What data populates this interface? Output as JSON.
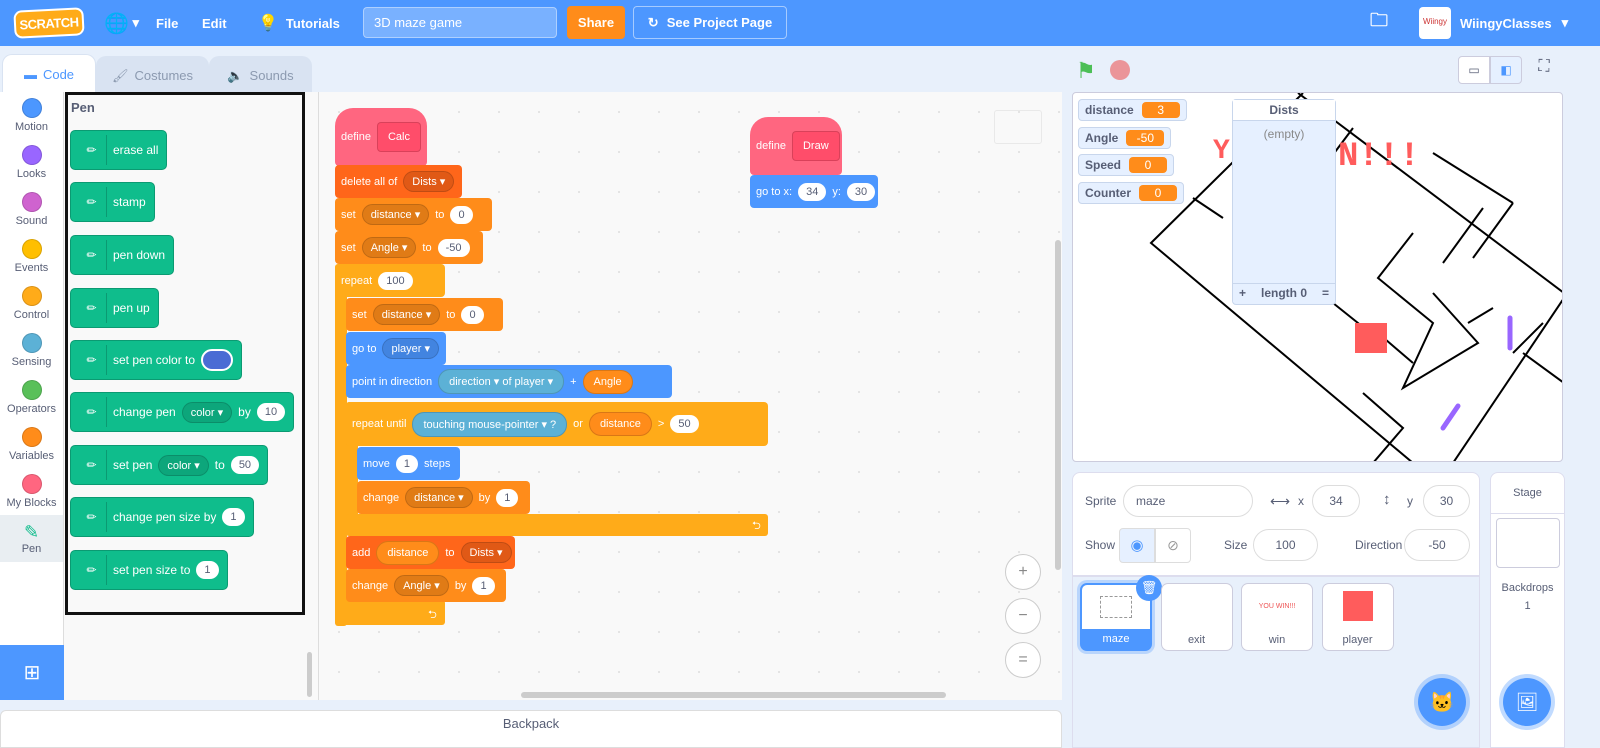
{
  "menubar": {
    "logo": "SCRATCH",
    "file": "File",
    "edit": "Edit",
    "tutorials": "Tutorials",
    "project_title": "3D maze game",
    "share": "Share",
    "see_project": "See Project Page",
    "username": "WiingyClasses"
  },
  "tabs": [
    {
      "label": "Code"
    },
    {
      "label": "Costumes"
    },
    {
      "label": "Sounds"
    }
  ],
  "categories": [
    {
      "label": "Motion",
      "color": "#4c97ff"
    },
    {
      "label": "Looks",
      "color": "#9966ff"
    },
    {
      "label": "Sound",
      "color": "#cf63cf"
    },
    {
      "label": "Events",
      "color": "#ffbf00"
    },
    {
      "label": "Control",
      "color": "#ffab19"
    },
    {
      "label": "Sensing",
      "color": "#5cb1d6"
    },
    {
      "label": "Operators",
      "color": "#59c059"
    },
    {
      "label": "Variables",
      "color": "#ff8c1a"
    },
    {
      "label": "My Blocks",
      "color": "#ff6680"
    },
    {
      "label": "Pen",
      "color": "#0fbd8c",
      "selected": true
    }
  ],
  "palette": {
    "heading": "Pen",
    "blocks": [
      {
        "parts": [
          {
            "t": "text",
            "v": "erase all"
          }
        ]
      },
      {
        "parts": [
          {
            "t": "text",
            "v": "stamp"
          }
        ]
      },
      {
        "parts": [
          {
            "t": "text",
            "v": "pen down"
          }
        ]
      },
      {
        "parts": [
          {
            "t": "text",
            "v": "pen up"
          }
        ]
      },
      {
        "parts": [
          {
            "t": "text",
            "v": "set pen color to"
          },
          {
            "t": "color",
            "v": "#4a6cd4"
          }
        ]
      },
      {
        "parts": [
          {
            "t": "text",
            "v": "change pen"
          },
          {
            "t": "dd",
            "v": "color ▾"
          },
          {
            "t": "text",
            "v": "by"
          },
          {
            "t": "num",
            "v": "10"
          }
        ]
      },
      {
        "parts": [
          {
            "t": "text",
            "v": "set pen"
          },
          {
            "t": "dd",
            "v": "color ▾"
          },
          {
            "t": "text",
            "v": "to"
          },
          {
            "t": "num",
            "v": "50"
          }
        ]
      },
      {
        "parts": [
          {
            "t": "text",
            "v": "change pen size by"
          },
          {
            "t": "num",
            "v": "1"
          }
        ]
      },
      {
        "parts": [
          {
            "t": "text",
            "v": "set pen size to"
          },
          {
            "t": "num",
            "v": "1"
          }
        ]
      }
    ]
  },
  "colors": {
    "motion": "#4c97ff",
    "control": "#ffab19",
    "variables": "#ff8c1a",
    "list": "#ff661a",
    "myblocks": "#ff6680",
    "sensing": "#5cb1d6",
    "operators": "#59c059",
    "pen": "#0fbd8c",
    "menubar": "#4d97ff"
  },
  "code": {
    "blocks": [
      {
        "cat": "myblocks",
        "parts": [
          {
            "t": "text",
            "v": "define"
          },
          {
            "t": "proto",
            "v": "Calc"
          }
        ]
      },
      {
        "cat": "list",
        "parts": [
          {
            "t": "text",
            "v": "delete all of"
          },
          {
            "t": "dd",
            "v": "Dists ▾"
          }
        ]
      },
      {
        "cat": "variables",
        "parts": [
          {
            "t": "text",
            "v": "set"
          },
          {
            "t": "dd",
            "v": "distance ▾"
          },
          {
            "t": "text",
            "v": "to"
          },
          {
            "t": "num",
            "v": "0"
          }
        ]
      },
      {
        "cat": "variables",
        "parts": [
          {
            "t": "text",
            "v": "set"
          },
          {
            "t": "dd",
            "v": "Angle ▾"
          },
          {
            "t": "text",
            "v": "to"
          },
          {
            "t": "num",
            "v": "-50"
          }
        ]
      },
      {
        "cat": "control",
        "parts": [
          {
            "t": "text",
            "v": "repeat"
          },
          {
            "t": "num",
            "v": "100"
          }
        ]
      },
      {
        "cat": "variables",
        "parts": [
          {
            "t": "text",
            "v": "set"
          },
          {
            "t": "dd",
            "v": "distance ▾"
          },
          {
            "t": "text",
            "v": "to"
          },
          {
            "t": "num",
            "v": "0"
          }
        ]
      },
      {
        "cat": "motion",
        "parts": [
          {
            "t": "text",
            "v": "go to"
          },
          {
            "t": "dd",
            "v": "player ▾"
          }
        ]
      },
      {
        "cat": "motion",
        "parts": [
          {
            "t": "text",
            "v": "point in direction"
          },
          {
            "t": "rep",
            "c": "sensing",
            "v": "direction ▾   of   player ▾"
          },
          {
            "t": "text",
            "v": "+"
          },
          {
            "t": "rep",
            "c": "variables",
            "v": "Angle"
          }
        ]
      },
      {
        "cat": "control",
        "parts": [
          {
            "t": "text",
            "v": "repeat until"
          },
          {
            "t": "rep",
            "c": "sensing",
            "v": "touching   mouse-pointer ▾   ?"
          },
          {
            "t": "text",
            "v": "or"
          },
          {
            "t": "rep",
            "c": "variables",
            "v": "distance"
          },
          {
            "t": "text",
            "v": ">"
          },
          {
            "t": "num",
            "v": "50"
          }
        ]
      },
      {
        "cat": "motion",
        "parts": [
          {
            "t": "text",
            "v": "move"
          },
          {
            "t": "num",
            "v": "1"
          },
          {
            "t": "text",
            "v": "steps"
          }
        ]
      },
      {
        "cat": "variables",
        "parts": [
          {
            "t": "text",
            "v": "change"
          },
          {
            "t": "dd",
            "v": "distance ▾"
          },
          {
            "t": "text",
            "v": "by"
          },
          {
            "t": "num",
            "v": "1"
          }
        ]
      },
      {
        "cat": "list",
        "parts": [
          {
            "t": "text",
            "v": "add"
          },
          {
            "t": "rep",
            "c": "variables",
            "v": "distance"
          },
          {
            "t": "text",
            "v": "to"
          },
          {
            "t": "dd",
            "v": "Dists ▾"
          }
        ]
      },
      {
        "cat": "variables",
        "parts": [
          {
            "t": "text",
            "v": "change"
          },
          {
            "t": "dd",
            "v": "Angle ▾"
          },
          {
            "t": "text",
            "v": "by"
          },
          {
            "t": "num",
            "v": "1"
          }
        ]
      },
      {
        "cat": "myblocks",
        "parts": [
          {
            "t": "text",
            "v": "define"
          },
          {
            "t": "proto",
            "v": "Draw"
          }
        ]
      },
      {
        "cat": "motion",
        "parts": [
          {
            "t": "text",
            "v": "go to x:"
          },
          {
            "t": "num",
            "v": "34"
          },
          {
            "t": "text",
            "v": "y:"
          },
          {
            "t": "num",
            "v": "30"
          }
        ]
      }
    ]
  },
  "zoom": {
    "in": "+",
    "out": "−",
    "reset": "="
  },
  "backpack": "Backpack",
  "stage": {
    "monitors": [
      {
        "label": "distance",
        "value": "3"
      },
      {
        "label": "Angle",
        "value": "-50"
      },
      {
        "label": "Speed",
        "value": "0"
      },
      {
        "label": "Counter",
        "value": "0"
      }
    ],
    "list": {
      "title": "Dists",
      "empty": "(empty)",
      "add": "+",
      "length": "length 0",
      "resize": "="
    }
  },
  "sprite_info": {
    "sprite_label": "Sprite",
    "sprite_name": "maze",
    "x_label": "x",
    "x": "34",
    "y_label": "y",
    "y": "30",
    "show_label": "Show",
    "size_label": "Size",
    "size": "100",
    "direction_label": "Direction",
    "direction": "-50"
  },
  "sprites": [
    {
      "name": "maze",
      "selected": true
    },
    {
      "name": "exit"
    },
    {
      "name": "win",
      "thumb_text": "YOU WIN!!!"
    },
    {
      "name": "player"
    }
  ],
  "stage_pane": {
    "title": "Stage",
    "backdrops_label": "Backdrops",
    "backdrops_count": "1"
  }
}
